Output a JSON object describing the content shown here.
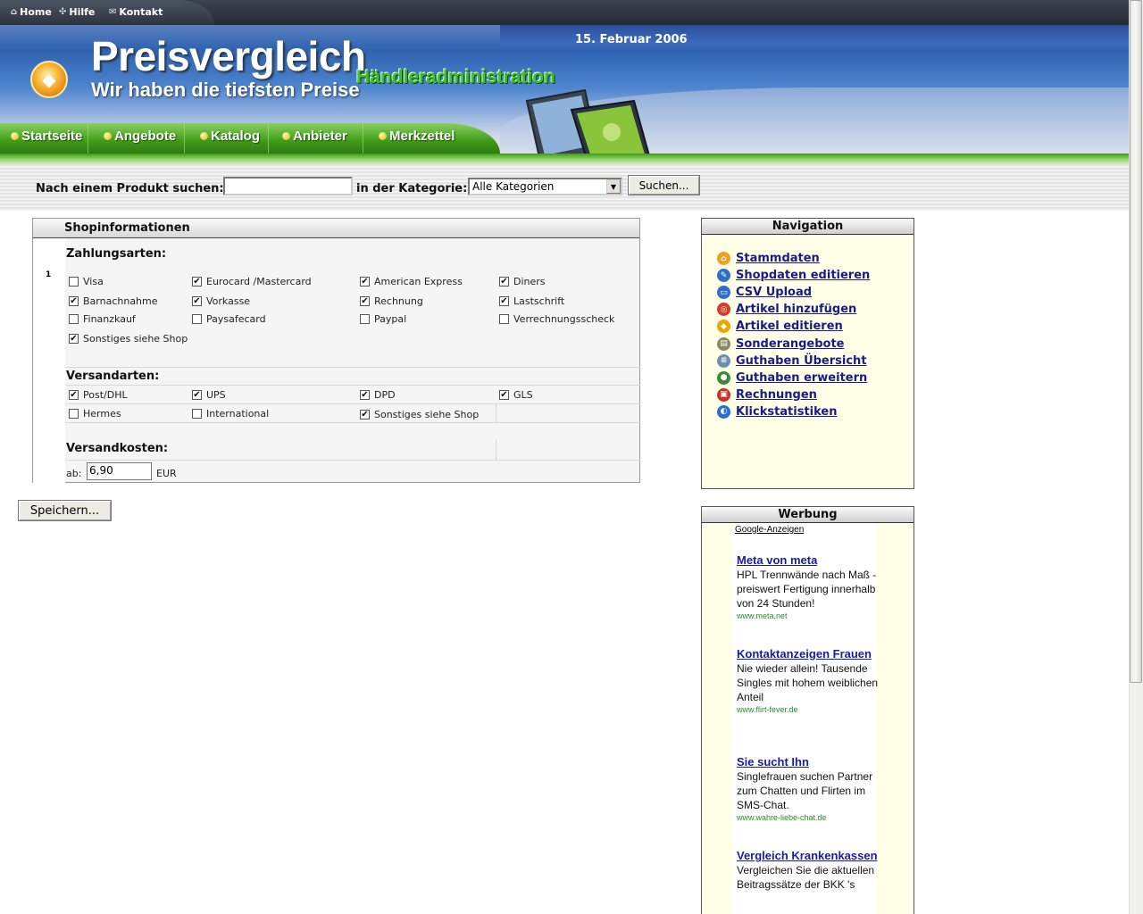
{
  "topbar": {
    "links": [
      {
        "label": "Home",
        "icon": "home-icon"
      },
      {
        "label": "Hilfe",
        "icon": "help-icon"
      },
      {
        "label": "Kontakt",
        "icon": "mail-icon"
      }
    ]
  },
  "header": {
    "date": "15. Februar 2006",
    "title": "Preisvergleich",
    "subtitle": "Wir haben die tiefsten Preise",
    "section": "Händleradministration"
  },
  "mainnav": {
    "items": [
      "Startseite",
      "Angebote",
      "Katalog",
      "Anbieter",
      "Merkzettel"
    ]
  },
  "search": {
    "label": "Nach einem Produkt suchen:",
    "value": "",
    "category_label": "in der Kategorie:",
    "category_selected": "Alle Kategorien",
    "button": "Suchen..."
  },
  "shop": {
    "header": "Shopinformationen",
    "number": "1",
    "payment_title": "Zahlungsarten:",
    "payment": [
      {
        "label": "Visa",
        "checked": false
      },
      {
        "label": "Eurocard /Mastercard",
        "checked": true
      },
      {
        "label": "American Express",
        "checked": true
      },
      {
        "label": "Diners",
        "checked": true
      },
      {
        "label": "Barnachnahme",
        "checked": true
      },
      {
        "label": "Vorkasse",
        "checked": true
      },
      {
        "label": "Rechnung",
        "checked": true
      },
      {
        "label": "Lastschrift",
        "checked": true
      },
      {
        "label": "Finanzkauf",
        "checked": false
      },
      {
        "label": "Paysafecard",
        "checked": false
      },
      {
        "label": "Paypal",
        "checked": false
      },
      {
        "label": "Verrechnungsscheck",
        "checked": false
      },
      {
        "label": "Sonstiges siehe Shop",
        "checked": true
      }
    ],
    "shipping_title": "Versandarten:",
    "shipping": [
      {
        "label": "Post/DHL",
        "checked": true
      },
      {
        "label": "UPS",
        "checked": true
      },
      {
        "label": "DPD",
        "checked": true
      },
      {
        "label": "GLS",
        "checked": true
      },
      {
        "label": "Hermes",
        "checked": false
      },
      {
        "label": "International",
        "checked": false
      },
      {
        "label": "Sonstiges siehe Shop",
        "checked": true
      }
    ],
    "cost_title": "Versandkosten:",
    "cost_prefix": "ab:",
    "cost_value": "6,90",
    "cost_unit": "EUR",
    "save_button": "Speichern..."
  },
  "navigation": {
    "title": "Navigation",
    "items": [
      {
        "label": "Stammdaten",
        "icon": "home-icon",
        "color": "#f0a020"
      },
      {
        "label": "Shopdaten editieren",
        "icon": "edit-doc-icon",
        "color": "#2f6fc8"
      },
      {
        "label": "CSV Upload",
        "icon": "monitor-icon",
        "color": "#2f6fc8"
      },
      {
        "label": "Artikel hinzufügen",
        "icon": "lifebuoy-icon",
        "color": "#d83a2a"
      },
      {
        "label": "Artikel editieren",
        "icon": "sign-icon",
        "color": "#e8a800"
      },
      {
        "label": "Sonderangebote",
        "icon": "tag-icon",
        "color": "#8a8a60"
      },
      {
        "label": "Guthaben Übersicht",
        "icon": "list-icon",
        "color": "#6f8fb0"
      },
      {
        "label": "Guthaben erweitern",
        "icon": "globe-icon",
        "color": "#3a8a3a"
      },
      {
        "label": "Rechnungen",
        "icon": "briefcase-icon",
        "color": "#c8302a"
      },
      {
        "label": "Klickstatistiken",
        "icon": "chart-globe-icon",
        "color": "#2a6fd0"
      }
    ]
  },
  "ads": {
    "title": "Werbung",
    "label": "Google-Anzeigen",
    "items": [
      {
        "title": "Meta von meta",
        "body": "HPL Trennwände nach Maß - preiswert Fertigung innerhalb von 24 Stunden!",
        "url": "www.meta.net"
      },
      {
        "title": "Kontaktanzeigen Frauen",
        "body": "Nie wieder allein! Tausende Singles mit hohem weiblichen Anteil",
        "url": "www.flirt-fever.de"
      },
      {
        "title": "Sie sucht Ihn",
        "body": "Singlefrauen suchen Partner zum Chatten und Flirten im SMS-Chat.",
        "url": "www.wahre-liebe-chat.de"
      },
      {
        "title": "Vergleich Krankenkassen",
        "body": "Vergleichen Sie die aktuellen Beitragssätze der BKK 's",
        "url": ""
      }
    ]
  }
}
